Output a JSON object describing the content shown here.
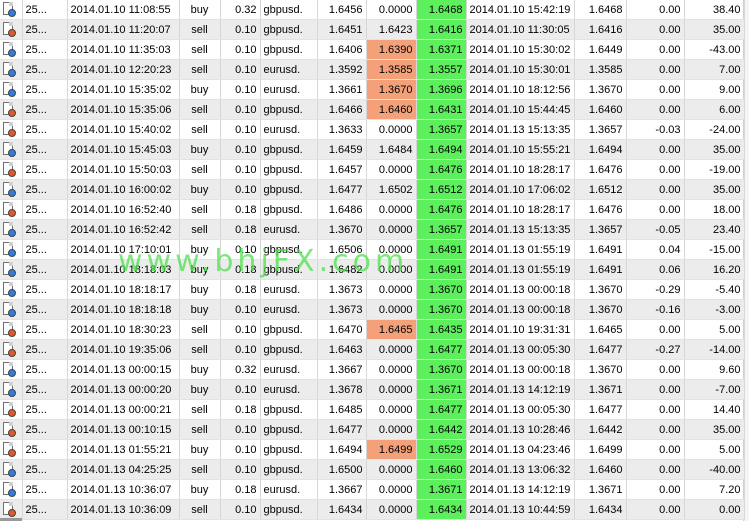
{
  "watermark": "www.bhjFX.com",
  "colors": {
    "positive_close": "#5df05d",
    "sl_hit": "#f4a078",
    "row_alt": "#ececec"
  },
  "rows": [
    {
      "icon": "order-buy-icon",
      "ticket": "25...",
      "open_time": "2014.01.10 11:08:55",
      "type": "buy",
      "size": "0.32",
      "symbol": "gbpusd.",
      "open_price": "1.6456",
      "sl": "0.0000",
      "tp": "1.6468",
      "close_time": "2014.01.10 15:42:19",
      "close_price": "1.6468",
      "swap": "0.00",
      "profit": "38.40"
    },
    {
      "icon": "order-sell-icon",
      "ticket": "25...",
      "open_time": "2014.01.10 11:20:07",
      "type": "sell",
      "size": "0.10",
      "symbol": "gbpusd.",
      "open_price": "1.6451",
      "sl": "1.6423",
      "tp": "1.6416",
      "close_time": "2014.01.10 11:30:05",
      "close_price": "1.6416",
      "swap": "0.00",
      "profit": "35.00"
    },
    {
      "icon": "order-buy-icon",
      "ticket": "25...",
      "open_time": "2014.01.10 11:35:03",
      "type": "sell",
      "size": "0.10",
      "symbol": "gbpusd.",
      "open_price": "1.6406",
      "sl": "1.6390",
      "tp": "1.6371",
      "close_time": "2014.01.10 15:30:02",
      "close_price": "1.6449",
      "swap": "0.00",
      "profit": "-43.00"
    },
    {
      "icon": "order-buy-icon",
      "ticket": "25...",
      "open_time": "2014.01.10 12:20:23",
      "type": "sell",
      "size": "0.10",
      "symbol": "eurusd.",
      "open_price": "1.3592",
      "sl": "1.3585",
      "tp": "1.3557",
      "close_time": "2014.01.10 15:30:01",
      "close_price": "1.3585",
      "swap": "0.00",
      "profit": "7.00"
    },
    {
      "icon": "order-buy-icon",
      "ticket": "25...",
      "open_time": "2014.01.10 15:35:02",
      "type": "buy",
      "size": "0.10",
      "symbol": "eurusd.",
      "open_price": "1.3661",
      "sl": "1.3670",
      "tp": "1.3696",
      "close_time": "2014.01.10 18:12:56",
      "close_price": "1.3670",
      "swap": "0.00",
      "profit": "9.00"
    },
    {
      "icon": "order-sell-icon",
      "ticket": "25...",
      "open_time": "2014.01.10 15:35:06",
      "type": "sell",
      "size": "0.10",
      "symbol": "gbpusd.",
      "open_price": "1.6466",
      "sl": "1.6460",
      "tp": "1.6431",
      "close_time": "2014.01.10 15:44:45",
      "close_price": "1.6460",
      "swap": "0.00",
      "profit": "6.00"
    },
    {
      "icon": "order-sell-icon",
      "ticket": "25...",
      "open_time": "2014.01.10 15:40:02",
      "type": "sell",
      "size": "0.10",
      "symbol": "eurusd.",
      "open_price": "1.3633",
      "sl": "0.0000",
      "tp": "1.3657",
      "close_time": "2014.01.13 15:13:35",
      "close_price": "1.3657",
      "swap": "-0.03",
      "profit": "-24.00"
    },
    {
      "icon": "order-buy-icon",
      "ticket": "25...",
      "open_time": "2014.01.10 15:45:03",
      "type": "buy",
      "size": "0.10",
      "symbol": "gbpusd.",
      "open_price": "1.6459",
      "sl": "1.6484",
      "tp": "1.6494",
      "close_time": "2014.01.10 15:55:21",
      "close_price": "1.6494",
      "swap": "0.00",
      "profit": "35.00"
    },
    {
      "icon": "order-sell-icon",
      "ticket": "25...",
      "open_time": "2014.01.10 15:50:03",
      "type": "sell",
      "size": "0.10",
      "symbol": "gbpusd.",
      "open_price": "1.6457",
      "sl": "0.0000",
      "tp": "1.6476",
      "close_time": "2014.01.10 18:28:17",
      "close_price": "1.6476",
      "swap": "0.00",
      "profit": "-19.00"
    },
    {
      "icon": "order-buy-icon",
      "ticket": "25...",
      "open_time": "2014.01.10 16:00:02",
      "type": "buy",
      "size": "0.10",
      "symbol": "gbpusd.",
      "open_price": "1.6477",
      "sl": "1.6502",
      "tp": "1.6512",
      "close_time": "2014.01.10 17:06:02",
      "close_price": "1.6512",
      "swap": "0.00",
      "profit": "35.00"
    },
    {
      "icon": "order-sell-icon",
      "ticket": "25...",
      "open_time": "2014.01.10 16:52:40",
      "type": "sell",
      "size": "0.18",
      "symbol": "gbpusd.",
      "open_price": "1.6486",
      "sl": "0.0000",
      "tp": "1.6476",
      "close_time": "2014.01.10 18:28:17",
      "close_price": "1.6476",
      "swap": "0.00",
      "profit": "18.00"
    },
    {
      "icon": "order-buy-icon",
      "ticket": "25...",
      "open_time": "2014.01.10 16:52:42",
      "type": "sell",
      "size": "0.18",
      "symbol": "eurusd.",
      "open_price": "1.3670",
      "sl": "0.0000",
      "tp": "1.3657",
      "close_time": "2014.01.13 15:13:35",
      "close_price": "1.3657",
      "swap": "-0.05",
      "profit": "23.40"
    },
    {
      "icon": "order-buy-icon",
      "ticket": "25...",
      "open_time": "2014.01.10 17:10:01",
      "type": "buy",
      "size": "0.10",
      "symbol": "gbpusd.",
      "open_price": "1.6506",
      "sl": "0.0000",
      "tp": "1.6491",
      "close_time": "2014.01.13 01:55:19",
      "close_price": "1.6491",
      "swap": "0.04",
      "profit": "-15.00"
    },
    {
      "icon": "order-buy-icon",
      "ticket": "25...",
      "open_time": "2014.01.10 18:18:03",
      "type": "buy",
      "size": "0.18",
      "symbol": "gbpusd.",
      "open_price": "1.6482",
      "sl": "0.0000",
      "tp": "1.6491",
      "close_time": "2014.01.13 01:55:19",
      "close_price": "1.6491",
      "swap": "0.06",
      "profit": "16.20"
    },
    {
      "icon": "order-buy-icon",
      "ticket": "25...",
      "open_time": "2014.01.10 18:18:17",
      "type": "buy",
      "size": "0.18",
      "symbol": "eurusd.",
      "open_price": "1.3673",
      "sl": "0.0000",
      "tp": "1.3670",
      "close_time": "2014.01.13 00:00:18",
      "close_price": "1.3670",
      "swap": "-0.29",
      "profit": "-5.40"
    },
    {
      "icon": "order-buy-icon",
      "ticket": "25...",
      "open_time": "2014.01.10 18:18:18",
      "type": "buy",
      "size": "0.10",
      "symbol": "eurusd.",
      "open_price": "1.3673",
      "sl": "0.0000",
      "tp": "1.3670",
      "close_time": "2014.01.13 00:00:18",
      "close_price": "1.3670",
      "swap": "-0.16",
      "profit": "-3.00"
    },
    {
      "icon": "order-sell-icon",
      "ticket": "25...",
      "open_time": "2014.01.10 18:30:23",
      "type": "sell",
      "size": "0.10",
      "symbol": "gbpusd.",
      "open_price": "1.6470",
      "sl": "1.6465",
      "tp": "1.6435",
      "close_time": "2014.01.10 19:31:31",
      "close_price": "1.6465",
      "swap": "0.00",
      "profit": "5.00"
    },
    {
      "icon": "order-sell-icon",
      "ticket": "25...",
      "open_time": "2014.01.10 19:35:06",
      "type": "sell",
      "size": "0.10",
      "symbol": "gbpusd.",
      "open_price": "1.6463",
      "sl": "0.0000",
      "tp": "1.6477",
      "close_time": "2014.01.13 00:05:30",
      "close_price": "1.6477",
      "swap": "-0.27",
      "profit": "-14.00"
    },
    {
      "icon": "order-buy-icon",
      "ticket": "25...",
      "open_time": "2014.01.13 00:00:15",
      "type": "buy",
      "size": "0.32",
      "symbol": "eurusd.",
      "open_price": "1.3667",
      "sl": "0.0000",
      "tp": "1.3670",
      "close_time": "2014.01.13 00:00:18",
      "close_price": "1.3670",
      "swap": "0.00",
      "profit": "9.60"
    },
    {
      "icon": "order-buy-icon",
      "ticket": "25...",
      "open_time": "2014.01.13 00:00:20",
      "type": "buy",
      "size": "0.10",
      "symbol": "eurusd.",
      "open_price": "1.3678",
      "sl": "0.0000",
      "tp": "1.3671",
      "close_time": "2014.01.13 14:12:19",
      "close_price": "1.3671",
      "swap": "0.00",
      "profit": "-7.00"
    },
    {
      "icon": "order-sell-icon",
      "ticket": "25...",
      "open_time": "2014.01.13 00:00:21",
      "type": "sell",
      "size": "0.18",
      "symbol": "gbpusd.",
      "open_price": "1.6485",
      "sl": "0.0000",
      "tp": "1.6477",
      "close_time": "2014.01.13 00:05:30",
      "close_price": "1.6477",
      "swap": "0.00",
      "profit": "14.40"
    },
    {
      "icon": "order-sell-icon",
      "ticket": "25...",
      "open_time": "2014.01.13 00:10:15",
      "type": "sell",
      "size": "0.10",
      "symbol": "gbpusd.",
      "open_price": "1.6477",
      "sl": "0.0000",
      "tp": "1.6442",
      "close_time": "2014.01.13 10:28:46",
      "close_price": "1.6442",
      "swap": "0.00",
      "profit": "35.00"
    },
    {
      "icon": "order-sell-icon",
      "ticket": "25...",
      "open_time": "2014.01.13 01:55:21",
      "type": "buy",
      "size": "0.10",
      "symbol": "gbpusd.",
      "open_price": "1.6494",
      "sl": "1.6499",
      "tp": "1.6529",
      "close_time": "2014.01.13 04:23:46",
      "close_price": "1.6499",
      "swap": "0.00",
      "profit": "5.00"
    },
    {
      "icon": "order-buy-icon",
      "ticket": "25...",
      "open_time": "2014.01.13 04:25:25",
      "type": "sell",
      "size": "0.10",
      "symbol": "gbpusd.",
      "open_price": "1.6500",
      "sl": "0.0000",
      "tp": "1.6460",
      "close_time": "2014.01.13 13:06:32",
      "close_price": "1.6460",
      "swap": "0.00",
      "profit": "-40.00"
    },
    {
      "icon": "order-buy-icon",
      "ticket": "25...",
      "open_time": "2014.01.13 10:36:07",
      "type": "buy",
      "size": "0.18",
      "symbol": "eurusd.",
      "open_price": "1.3667",
      "sl": "0.0000",
      "tp": "1.3671",
      "close_time": "2014.01.13 14:12:19",
      "close_price": "1.3671",
      "swap": "0.00",
      "profit": "7.20"
    },
    {
      "icon": "order-sell-icon",
      "ticket": "25...",
      "open_time": "2014.01.13 10:36:09",
      "type": "sell",
      "size": "0.10",
      "symbol": "gbpusd.",
      "open_price": "1.6434",
      "sl": "0.0000",
      "tp": "1.6434",
      "close_time": "2014.01.13 10:44:59",
      "close_price": "1.6434",
      "swap": "0.00",
      "profit": "0.00"
    }
  ],
  "highlight": {
    "tp_green_rows": [
      0,
      1,
      2,
      3,
      4,
      5,
      6,
      7,
      8,
      9,
      10,
      11,
      12,
      13,
      14,
      15,
      16,
      17,
      18,
      19,
      20,
      21,
      22,
      23,
      24,
      25
    ],
    "sl_red_rows": [
      2,
      3,
      4,
      5,
      16,
      22
    ]
  }
}
